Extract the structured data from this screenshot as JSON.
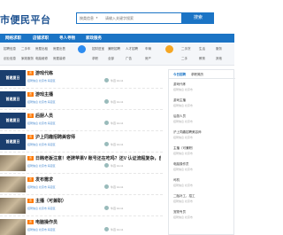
{
  "brand": "市便民平台",
  "search": {
    "select_label": "按类信息",
    "placeholder": "请输入关键字搜索",
    "button_label": "搜索"
  },
  "nav": [
    "网络求职",
    "店铺求职",
    "寻人寻物",
    "家政服务"
  ],
  "categories": {
    "row1": [
      "招聘信息",
      "二手车",
      "房屋出租",
      "房屋出售",
      "招财进宝",
      "兼职招聘",
      "人才招聘",
      "车辆",
      "二手货",
      "生活",
      "服务"
    ],
    "row2": [
      "创业信息",
      "家政服务",
      "电脑维修",
      "房屋装修",
      "求职",
      "全部",
      "广告",
      "房产",
      "二手",
      "教育",
      "其他"
    ]
  },
  "listings": [
    {
      "thumb": "首邀夏日",
      "title": "游戏代练",
      "sub": "招聘信息 北京市 海淀区",
      "meta": "牛百 12-11"
    },
    {
      "thumb": "首邀夏日",
      "title": "游戏主播",
      "sub": "招聘信息 北京市 海淀区",
      "meta": "牛百 12-11"
    },
    {
      "thumb": "首邀夏日",
      "title": "后厨人员",
      "sub": "招聘信息 北京市 海淀区",
      "meta": "牛百 12-11"
    },
    {
      "thumb": "首邀夏日",
      "title": "沪上同趣招聘美容师",
      "sub": "招聘信息 北京市 海淀区",
      "meta": "牛百 12-11"
    },
    {
      "thumb": "",
      "title": "日韩老板注意！老牌苹果V 账号还在吃吗？还V 认证流程复杂，自...",
      "sub": "招聘信息 北京市 海淀区",
      "meta": "牛百 12-11"
    },
    {
      "thumb": "",
      "title": "发布需求",
      "sub": "招聘信息 北京市 海淀区",
      "meta": "牛百 12-11"
    },
    {
      "thumb": "",
      "title": "主播（可兼职）",
      "sub": "招聘信息 北京市 海淀区",
      "meta": "牛百 12-11"
    },
    {
      "thumb": "",
      "title": "电脑操作员",
      "sub": "招聘信息 北京市 海淀区",
      "meta": "牛百 12-11"
    }
  ],
  "sidebar": {
    "tabs": [
      "今日招聘",
      "求职简历"
    ],
    "items": [
      {
        "title": "游戏代练",
        "sub": "招聘信息 北京市"
      },
      {
        "title": "游戏主播",
        "sub": "招聘信息 北京市"
      },
      {
        "title": "后厨人员",
        "sub": "招聘信息 北京市"
      },
      {
        "title": "沪上同趣招聘美容师",
        "sub": "招聘信息 北京市"
      },
      {
        "title": "主播（可兼职）",
        "sub": "招聘信息 北京市"
      },
      {
        "title": "电脑操作员",
        "sub": "招聘信息 北京市"
      },
      {
        "title": "司机",
        "sub": "招聘信息 北京市"
      },
      {
        "title": "二胎补工、招工",
        "sub": "招聘信息 北京市"
      },
      {
        "title": "宠物专员",
        "sub": "招聘信息 北京市"
      }
    ]
  },
  "colors": {
    "accent": "#1b74c5",
    "brand": "#1a4f8f",
    "badge": "#ff7a00"
  }
}
